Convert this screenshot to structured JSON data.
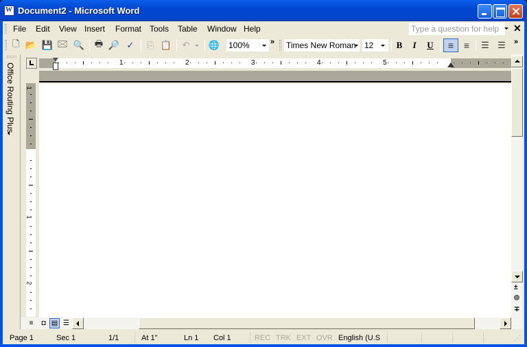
{
  "window": {
    "title": "Document2 - Microsoft Word",
    "controls": {
      "minimize": "minimize",
      "maximize": "maximize",
      "close": "close"
    }
  },
  "menubar": {
    "items": [
      {
        "label": "File",
        "accel": "F"
      },
      {
        "label": "Edit",
        "accel": "E"
      },
      {
        "label": "View",
        "accel": "V"
      },
      {
        "label": "Insert",
        "accel": "I"
      },
      {
        "label": "Format",
        "accel": "o"
      },
      {
        "label": "Tools",
        "accel": "T"
      },
      {
        "label": "Table",
        "accel": "a"
      },
      {
        "label": "Window",
        "accel": "W"
      },
      {
        "label": "Help",
        "accel": "H"
      }
    ],
    "help_placeholder": "Type a question for help",
    "close_doc": "✕"
  },
  "toolbar": {
    "standard": [
      {
        "name": "new-icon",
        "glyph": "🗋"
      },
      {
        "name": "open-icon",
        "glyph": "📂"
      },
      {
        "name": "save-icon",
        "glyph": "💾"
      },
      {
        "name": "permission-icon",
        "glyph": "🖂"
      },
      {
        "name": "search-icon",
        "glyph": "🔍"
      },
      {
        "name": "print-icon",
        "glyph": "🖶"
      },
      {
        "name": "print-preview-icon",
        "glyph": "🔎"
      },
      {
        "name": "spelling-icon",
        "glyph": "✓"
      },
      {
        "name": "copy-icon",
        "glyph": "⎘"
      },
      {
        "name": "paste-icon",
        "glyph": "📋"
      },
      {
        "name": "undo-icon",
        "glyph": "↶"
      },
      {
        "name": "web-icon",
        "glyph": "🌐"
      }
    ],
    "zoom": "100%",
    "font": "Times New Roman",
    "font_size": "12",
    "bold": "B",
    "italic": "I",
    "underline": "U",
    "more": "»"
  },
  "taskpane": {
    "label": "Office Routing Plus"
  },
  "ruler": {
    "h_labels": [
      "1",
      "2",
      "3",
      "4",
      "5"
    ],
    "v_labels": [
      "1",
      "1",
      "2"
    ]
  },
  "statusbar": {
    "page": "Page  1",
    "sec": "Sec  1",
    "pages": "1/1",
    "at": "At  1\"",
    "ln": "Ln  1",
    "col": "Col  1",
    "rec": "REC",
    "trk": "TRK",
    "ext": "EXT",
    "ovr": "OVR",
    "language": "English (U.S"
  }
}
